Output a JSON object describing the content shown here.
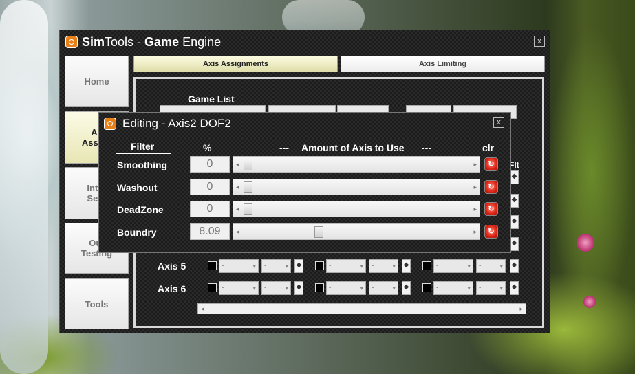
{
  "main_window": {
    "title_bold1": "Sim",
    "title_normal1": "Tools - ",
    "title_bold2": "Game",
    "title_normal2": " Engine",
    "close_label": "x"
  },
  "nav": {
    "home": "Home",
    "axis_line1": "Ax",
    "axis_line2": "Assign",
    "interface_line1": "Inter",
    "interface_line2": "Setti",
    "output_line1": "Out",
    "output_line2": "Testing",
    "tools": "Tools"
  },
  "tabs": {
    "axis_assignments": "Axis Assignments",
    "axis_limiting": "Axis Limiting"
  },
  "panel": {
    "game_list_label": "Game List",
    "flt_label": "Flt",
    "rows": [
      {
        "label": "Axis 5",
        "dropdown_value": "-"
      },
      {
        "label": "Axis 6",
        "dropdown_value": "-"
      }
    ],
    "small_button_label": "◆"
  },
  "dialog": {
    "title": "Editing - Axis2 DOF2",
    "close_label": "x",
    "headers": {
      "filter": "Filter",
      "percent": "%",
      "dash_left": "---",
      "amount": "Amount of Axis to Use",
      "dash_right": "---",
      "clr": "clr"
    },
    "filters": [
      {
        "name": "Smoothing",
        "value": "0",
        "level": 0.0
      },
      {
        "name": "Washout",
        "value": "0",
        "level": 0.0
      },
      {
        "name": "DeadZone",
        "value": "0",
        "level": 0.0
      },
      {
        "name": "Boundry",
        "value": "8.09",
        "level": 0.0809
      }
    ],
    "scroll_left": "◂",
    "scroll_right": "▸"
  },
  "colors": {
    "active_button": "#e8e6b4",
    "clear_button": "#e02a1a",
    "app_icon": "#e8801a"
  }
}
